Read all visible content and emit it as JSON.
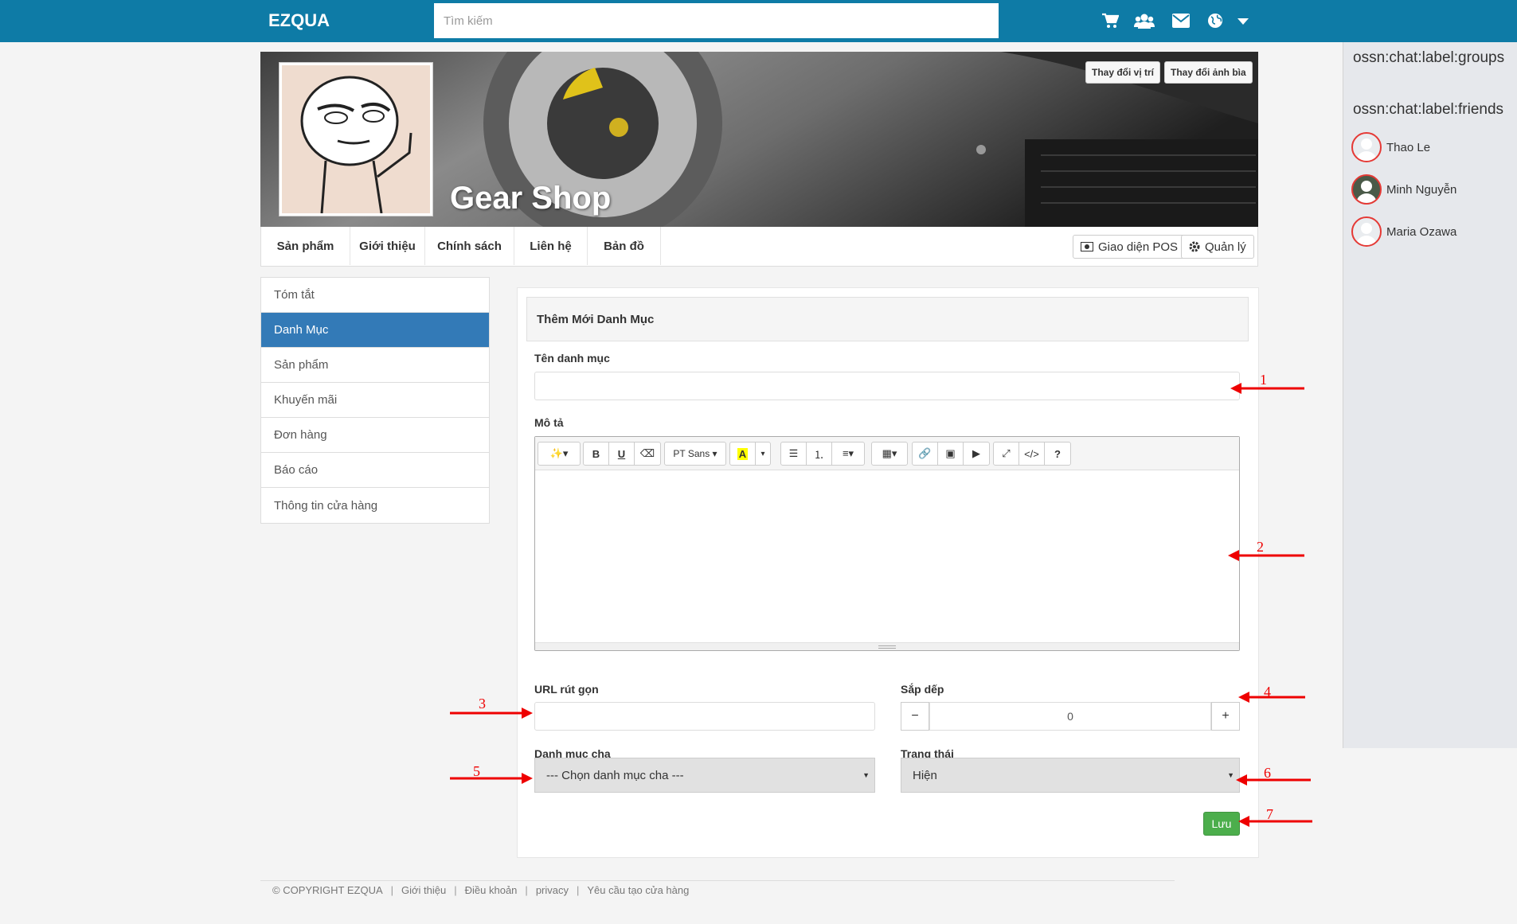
{
  "topbar": {
    "logo": "EZQUA",
    "search_placeholder": "Tìm kiếm",
    "icons": [
      "cart-icon",
      "users-icon",
      "envelope-icon",
      "globe-icon",
      "caret-down-icon"
    ]
  },
  "chat": {
    "groups_label": "ossn:chat:label:groups",
    "friends_label": "ossn:chat:label:friends",
    "friends": [
      {
        "name": "Thao Le"
      },
      {
        "name": "Minh Nguyễn"
      },
      {
        "name": "Maria Ozawa"
      }
    ]
  },
  "cover": {
    "shop_name": "Gear Shop",
    "change_position_label": "Thay đổi vị trí",
    "change_cover_label": "Thay đổi ảnh bìa"
  },
  "profile_nav": {
    "tabs": [
      {
        "label": "Sản phẩm"
      },
      {
        "label": "Giới thiệu"
      },
      {
        "label": "Chính sách"
      },
      {
        "label": "Liên hệ"
      },
      {
        "label": "Bản đồ"
      }
    ],
    "pos_label": "Giao diện POS",
    "manage_label": "Quản lý"
  },
  "sidemenu": {
    "items": [
      {
        "label": "Tóm tắt"
      },
      {
        "label": "Danh Mục"
      },
      {
        "label": "Sản phẩm"
      },
      {
        "label": "Khuyến mãi"
      },
      {
        "label": "Đơn hàng"
      },
      {
        "label": "Báo cáo"
      },
      {
        "label": "Thông tin cửa hàng"
      }
    ],
    "active_index": 1
  },
  "form": {
    "heading": "Thêm Mới Danh Mục",
    "name_label": "Tên danh mục",
    "name_value": "",
    "description_label": "Mô tả",
    "editor_font": "PT Sans",
    "url_label": "URL rút gọn",
    "url_value": "",
    "sort_label": "Sắp dếp",
    "sort_value": "0",
    "sort_minus": "−",
    "sort_plus": "+",
    "parent_label": "Danh mục cha",
    "parent_selected": "--- Chọn danh mục cha ---",
    "status_label": "Trạng thái",
    "status_selected": "Hiện",
    "save_label": "Lưu"
  },
  "annotations": [
    "1",
    "2",
    "3",
    "4",
    "5",
    "6",
    "7"
  ],
  "footer": {
    "copyright": "© COPYRIGHT EZQUA",
    "links": [
      "Giới thiệu",
      "Điều khoản",
      "privacy",
      "Yêu cầu tạo cửa hàng"
    ]
  },
  "colors": {
    "topbar": "#0e7ba6",
    "active_menu": "#337ab7",
    "save_button": "#4cae4c",
    "annotation": "#e00000"
  }
}
